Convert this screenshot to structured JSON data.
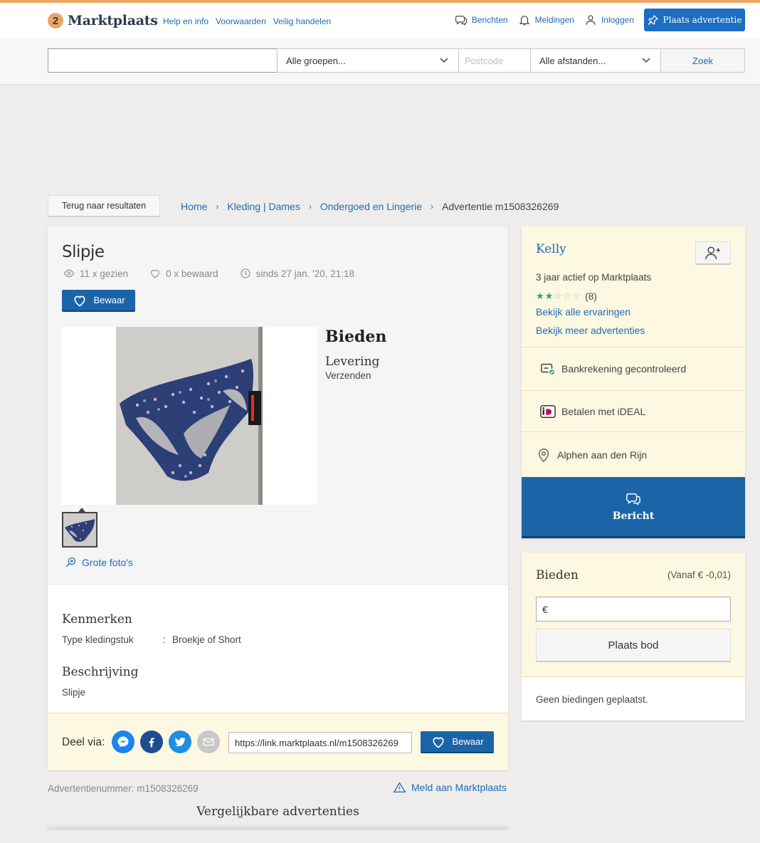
{
  "header": {
    "logo_text": "Marktplaats",
    "links": [
      "Help en info",
      "Voorwaarden",
      "Veilig handelen"
    ],
    "berichten": "Berichten",
    "meldingen": "Meldingen",
    "inloggen": "Inloggen",
    "post_ad": "Plaats advertentie"
  },
  "search": {
    "query": "",
    "groups": "Alle groepen...",
    "postcode_placeholder": "Postcode",
    "distance": "Alle afstanden...",
    "submit": "Zoek"
  },
  "breadcrumb": {
    "back": "Terug naar resultaten",
    "items": [
      "Home",
      "Kleding | Dames",
      "Ondergoed en Lingerie"
    ],
    "current": "Advertentie m1508326269"
  },
  "listing": {
    "title": "Slipje",
    "views": "11 x gezien",
    "saves": "0 x bewaard",
    "since": "sinds 27 jan. '20, 21:18",
    "bewaar": "Bewaar",
    "price_label": "Bieden",
    "levering_label": "Levering",
    "levering_value": "Verzenden",
    "grote_fotos": "Grote foto's",
    "kenmerken_title": "Kenmerken",
    "kenmerken": [
      {
        "key": "Type kledingstuk",
        "value": "Broekje of Short"
      }
    ],
    "beschrijving_title": "Beschrijving",
    "beschrijving": "Slipje"
  },
  "share": {
    "label": "Deel via:",
    "url": "https://link.marktplaats.nl/m1508326269",
    "bewaar": "Bewaar"
  },
  "footer": {
    "ad_number": "Advertentienummer: m1508326269",
    "report": "Meld aan Marktplaats",
    "similar": "Vergelijkbare advertenties"
  },
  "seller": {
    "name": "Kelly",
    "active": "3 jaar actief op Marktplaats",
    "rating": 2,
    "rating_max": 5,
    "rating_count": "(8)",
    "link_reviews": "Bekijk alle ervaringen",
    "link_more": "Bekijk meer advertenties",
    "bank": "Bankrekening gecontroleerd",
    "ideal": "Betalen met iDEAL",
    "location": "Alphen aan den Rijn",
    "message": "Bericht"
  },
  "bid": {
    "title": "Bieden",
    "from": "(Vanaf € -0,01)",
    "currency": "€",
    "submit": "Plaats bod",
    "none": "Geen biedingen geplaatst."
  },
  "colors": {
    "brand_blue": "#1b64a8",
    "link_blue": "#1e6bb5",
    "logo_orange": "#eda566",
    "highlight_yellow": "#fdf8e1",
    "star_green": "#26a870"
  }
}
